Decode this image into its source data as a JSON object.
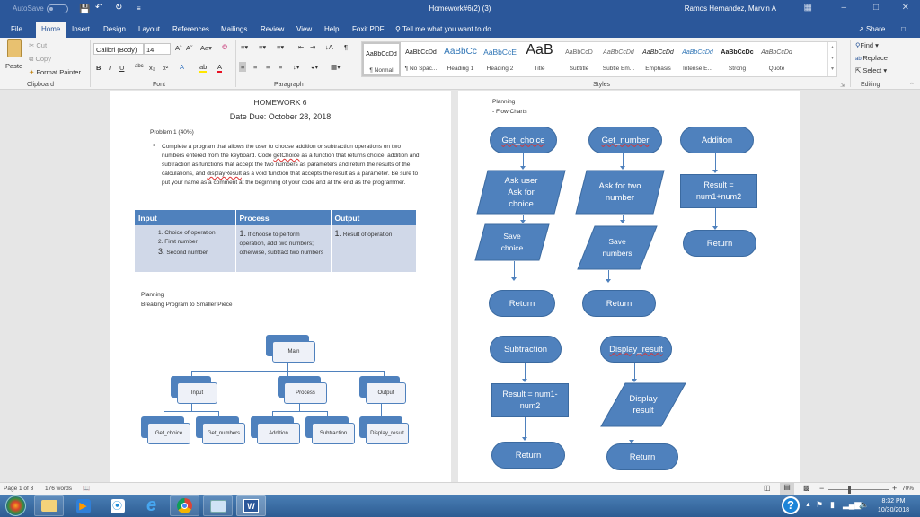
{
  "titlebar": {
    "autosave_label": "AutoSave",
    "autosave_state": "Off",
    "document_title": "Homework#6(2) (3)",
    "user_name": "Ramos Hernandez, Marvin A"
  },
  "tabs": [
    {
      "label": "File"
    },
    {
      "label": "Home",
      "active": true
    },
    {
      "label": "Insert"
    },
    {
      "label": "Design"
    },
    {
      "label": "Layout"
    },
    {
      "label": "References"
    },
    {
      "label": "Mailings"
    },
    {
      "label": "Review"
    },
    {
      "label": "View"
    },
    {
      "label": "Help"
    },
    {
      "label": "Foxit PDF"
    }
  ],
  "tell_me": "Tell me what you want to do",
  "share_label": "Share",
  "ribbon": {
    "clipboard": {
      "paste": "Paste",
      "cut": "Cut",
      "copy": "Copy",
      "format_painter": "Format Painter",
      "label": "Clipboard"
    },
    "font": {
      "font_name": "Calibri (Body)",
      "font_size": "14",
      "label": "Font"
    },
    "paragraph": {
      "label": "Paragraph"
    },
    "styles": {
      "label": "Styles",
      "items": [
        {
          "preview": "AaBbCcDd",
          "name": "¶ Normal",
          "selected": true
        },
        {
          "preview": "AaBbCcDd",
          "name": "¶ No Spac..."
        },
        {
          "preview": "AaBbCc",
          "name": "Heading 1"
        },
        {
          "preview": "AaBbCcE",
          "name": "Heading 2"
        },
        {
          "preview": "AaB",
          "name": "Title"
        },
        {
          "preview": "AaBbCcD",
          "name": "Subtitle"
        },
        {
          "preview": "AaBbCcDd",
          "name": "Subtle Em..."
        },
        {
          "preview": "AaBbCcDd",
          "name": "Emphasis"
        },
        {
          "preview": "AaBbCcDd",
          "name": "Intense E..."
        },
        {
          "preview": "AaBbCcDc",
          "name": "Strong"
        },
        {
          "preview": "AaBbCcDd",
          "name": "Quote"
        }
      ]
    },
    "editing": {
      "find": "Find",
      "replace": "Replace",
      "select": "Select",
      "label": "Editing"
    }
  },
  "page1": {
    "title": "HOMEWORK 6",
    "date_due": "Date Due: October 28, 2018",
    "problem": "Problem 1 (40%)",
    "bullet_parts": [
      "Complete a program that allows the user to choose addition or subtraction operations on two numbers entered from the keyboard.  Code ",
      "getChoice",
      " as a function that returns choice, addition and subtraction as functions that accept the two numbers as parameters and return the results of the calculations, and ",
      "displayResult",
      " as a void function that accepts the result as a parameter.  Be sure to put your name as a comment at the beginning of your code and at the end as the programmer."
    ],
    "ipo_table": {
      "headers": [
        "Input",
        "Process",
        "Output"
      ],
      "input_items": [
        {
          "num": "1.",
          "text": "Choice of operation"
        },
        {
          "num": "2.",
          "text": "First number"
        },
        {
          "num": "3.",
          "text": "Second number"
        }
      ],
      "process_num": "1.",
      "process_text": "If choose to perform operation, add two numbers; otherwise, subtract two numbers",
      "output_num": "1.",
      "output_text": "Result of operation"
    },
    "planning": "Planning",
    "planning_sub": "Breaking Program to Smaller Piece",
    "hierarchy": {
      "root": "Main",
      "level1": [
        "Input",
        "Process",
        "Output"
      ],
      "level2": [
        "Get_choice",
        "Get_numbers",
        "Addition",
        "Subtraction",
        "Display_result"
      ]
    }
  },
  "page2": {
    "planning": "Planning",
    "planning_sub": "- Flow Charts",
    "flow": {
      "get_choice": "Get_choice",
      "ask_choice": "Ask user Ask for choice",
      "save_choice": "Save choice",
      "return1": "Return",
      "get_number": "Get_number",
      "ask_numbers": "Ask for two number",
      "save_numbers": "Save numbers",
      "return2": "Return",
      "addition": "Addition",
      "add_result": "Result = num1+num2",
      "return3": "Return",
      "subtraction": "Subtraction",
      "sub_result": "Result = num1-num2",
      "return4": "Return",
      "display_result": "Display_result",
      "display": "Display result",
      "return5": "Return"
    }
  },
  "statusbar": {
    "page": "Page 1 of 3",
    "words": "176 words",
    "zoom": "70%",
    "zoom_percent": 70
  },
  "taskbar": {
    "time": "8:32 PM",
    "date": "10/30/2018"
  },
  "colors": {
    "word_blue": "#2b579a",
    "shape_blue": "#4f81bd",
    "table_body": "#d0d8e8"
  }
}
